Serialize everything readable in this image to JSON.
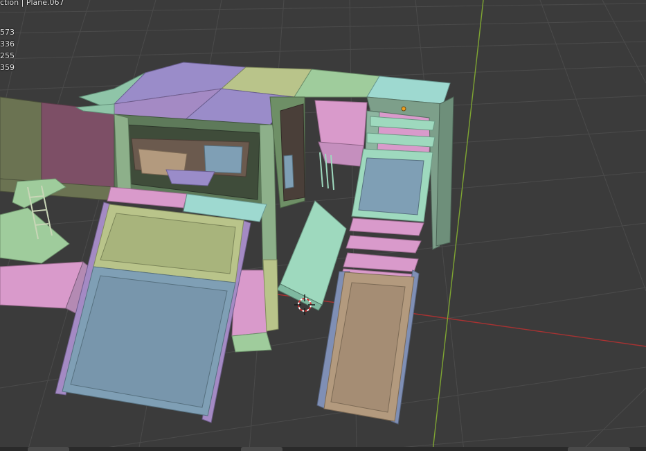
{
  "viewport": {
    "header_text": "ction | Plane.067",
    "stats": [
      "573",
      "336",
      "255",
      "359"
    ]
  },
  "colors": {
    "background": "#3b3b3b",
    "grid": "#4a4a4a",
    "x_axis": "#a83232",
    "y_axis": "#7fa632",
    "mesh_purple": "#9a8cc9",
    "mesh_green": "#9fcc9c",
    "mesh_mint": "#9ed9be",
    "mesh_olive": "#b9c48a",
    "mesh_pink": "#d99acb",
    "mesh_blue": "#7f9fb5",
    "mesh_tan": "#b39a7e",
    "mesh_lavender": "#a48ac4"
  },
  "icons": [
    "3d-cursor-icon",
    "origin-point-icon"
  ]
}
